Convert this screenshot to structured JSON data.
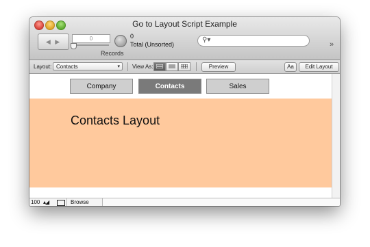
{
  "window": {
    "title": "Go to Layout Script Example"
  },
  "toolbar": {
    "record_number": "0",
    "records_label": "Records",
    "found_count": "0",
    "total_label": "Total (Unsorted)",
    "search_placeholder": "",
    "overflow_glyph": "»"
  },
  "layout_bar": {
    "layout_label": "Layout:",
    "layout_value": "Contacts",
    "view_as_label": "View As:",
    "preview_label": "Preview",
    "format_label": "Aa",
    "edit_layout_label": "Edit Layout"
  },
  "tabs": [
    {
      "label": "Company",
      "active": false
    },
    {
      "label": "Contacts",
      "active": true
    },
    {
      "label": "Sales",
      "active": false
    }
  ],
  "content": {
    "heading": "Contacts Layout",
    "body_color": "#ffc99d"
  },
  "status_bar": {
    "zoom": "100",
    "mode": "Browse"
  }
}
